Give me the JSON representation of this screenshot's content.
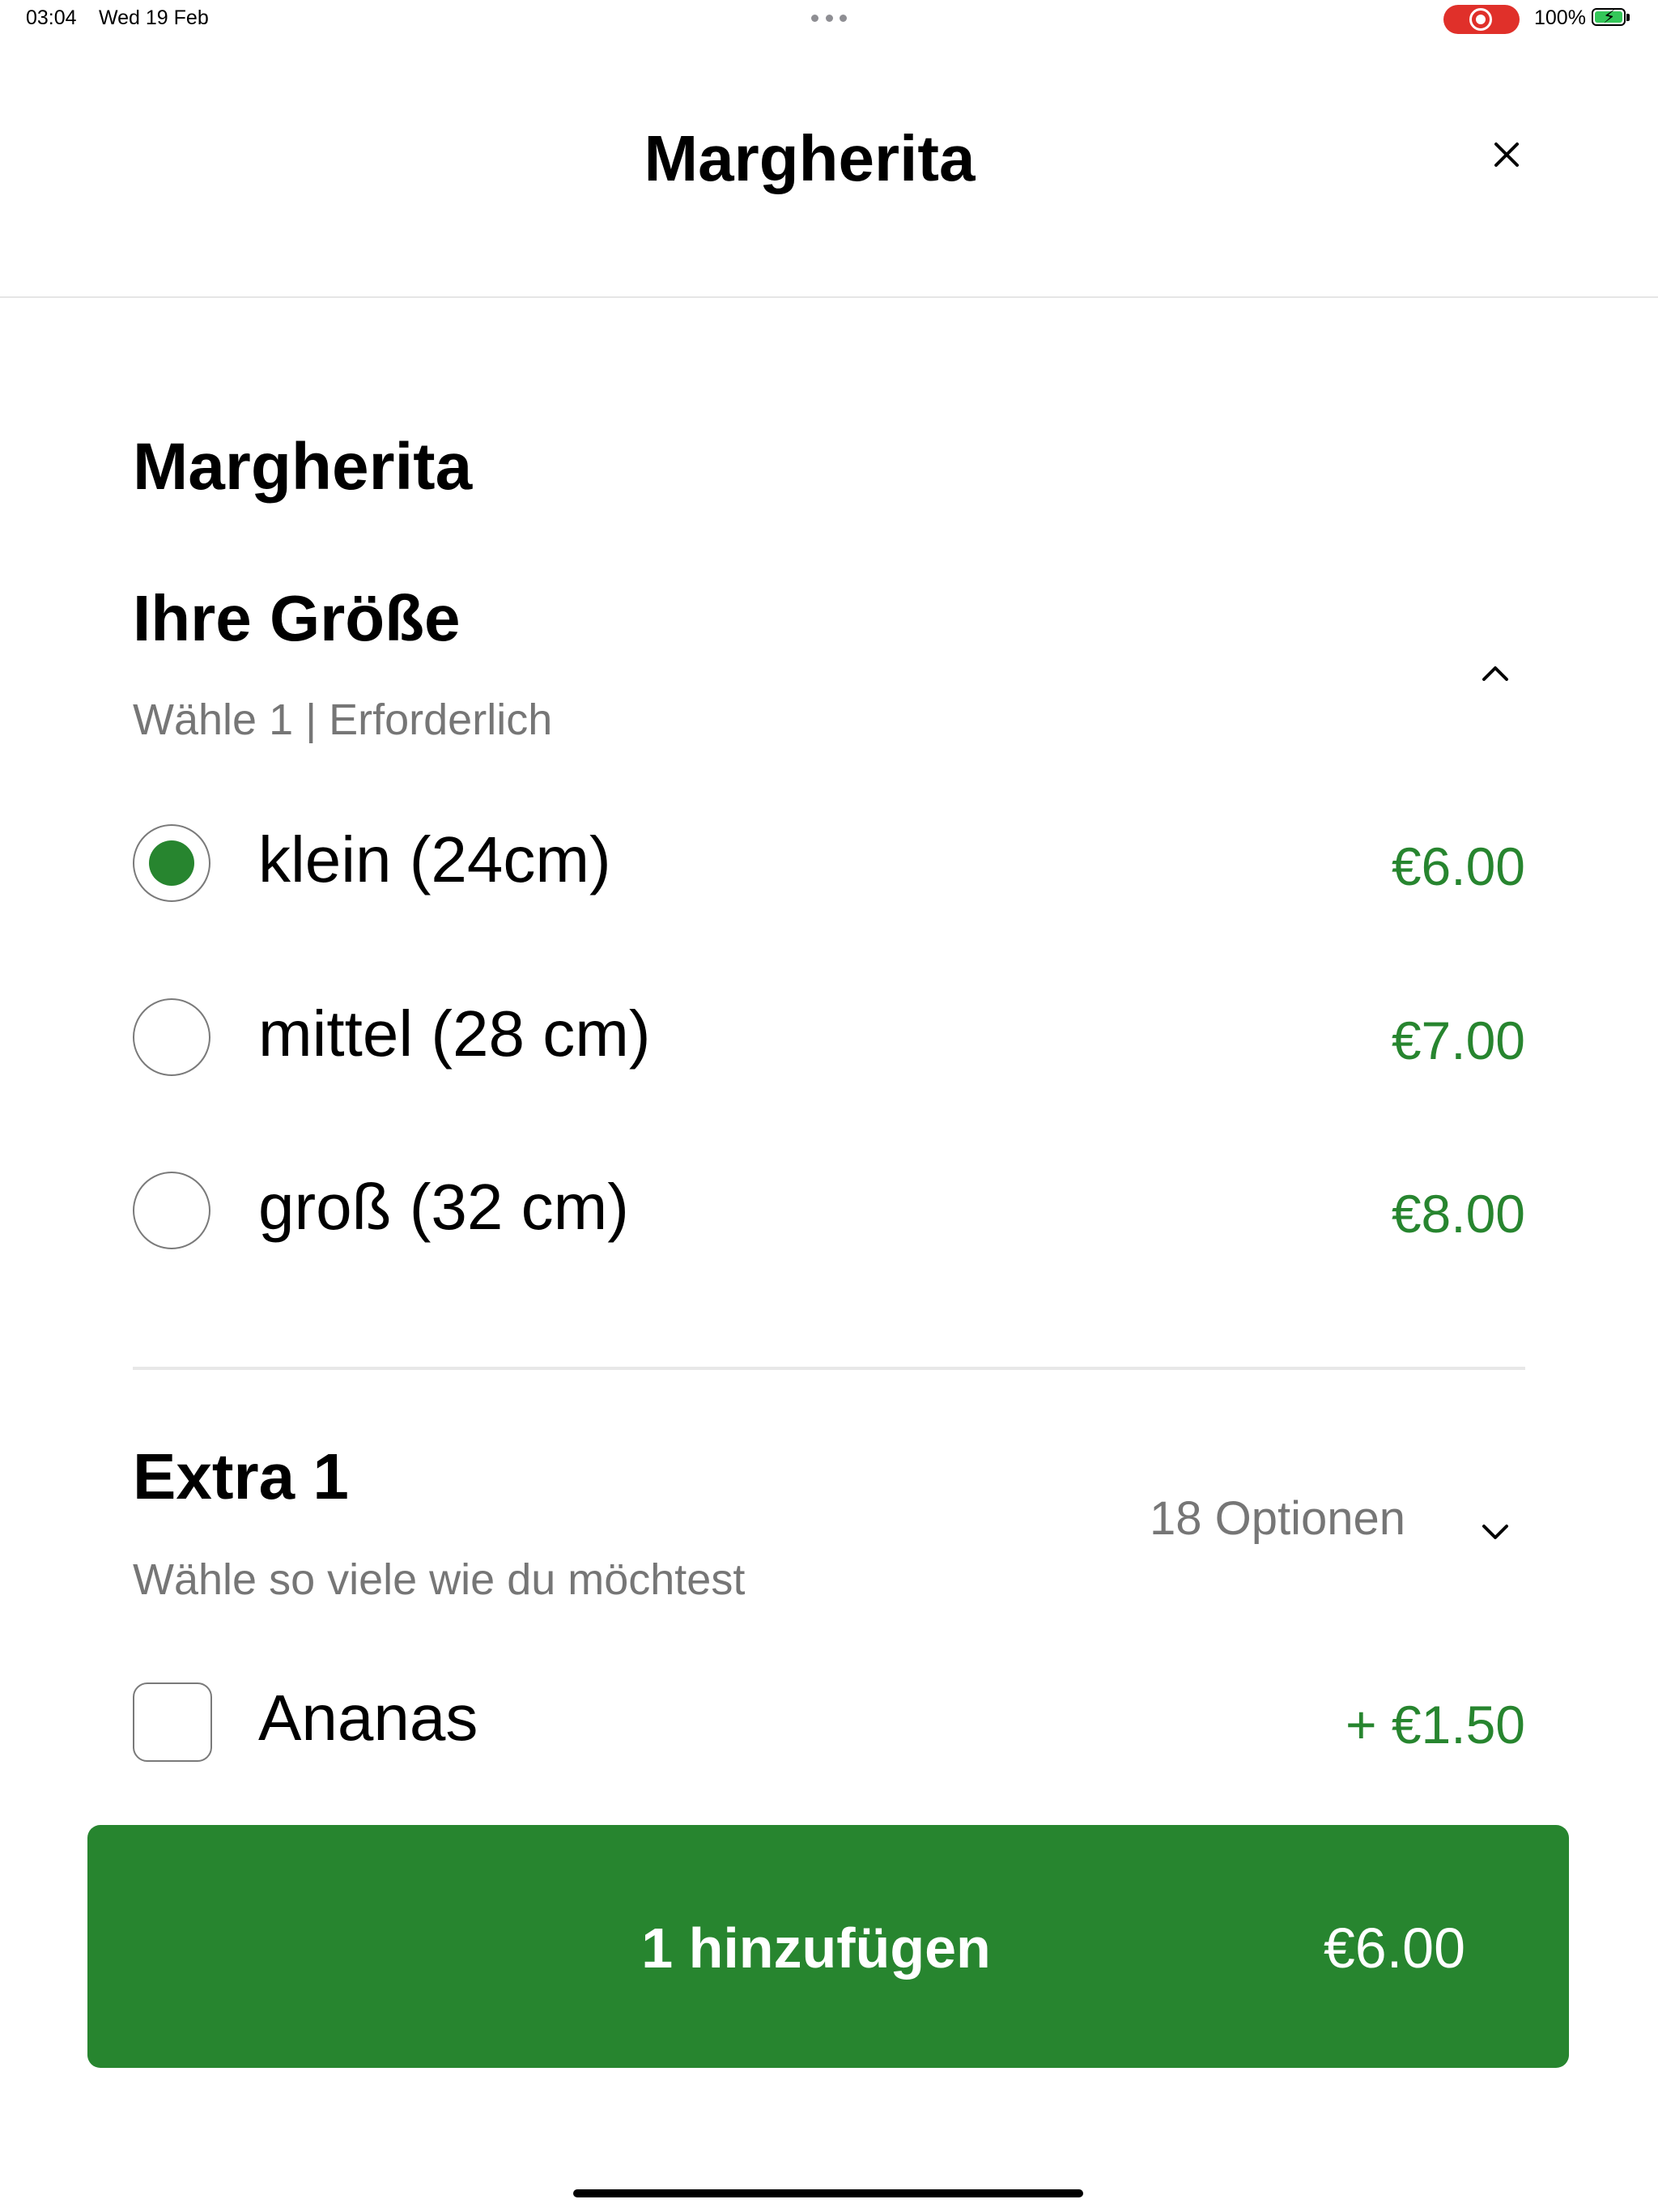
{
  "status_bar": {
    "time": "03:04",
    "date": "Wed 19 Feb",
    "battery": "100%"
  },
  "header": {
    "title": "Margherita",
    "close_icon": "close-icon"
  },
  "item": {
    "title": "Margherita"
  },
  "size_section": {
    "title": "Ihre Größe",
    "subtitle": "Wähle 1  |  Erforderlich",
    "options": [
      {
        "label": "klein (24cm)",
        "price": "€6.00",
        "selected": true
      },
      {
        "label": "mittel (28 cm)",
        "price": "€7.00",
        "selected": false
      },
      {
        "label": "groß (32 cm)",
        "price": "€8.00",
        "selected": false
      }
    ]
  },
  "extra_section": {
    "title": "Extra 1",
    "subtitle": "Wähle so viele wie du möchtest",
    "count": "18 Optionen",
    "options": [
      {
        "label": "Ananas",
        "price": "+ €1.50",
        "checked": false
      }
    ]
  },
  "add_button": {
    "label": "1 hinzufügen",
    "price": "€6.00"
  },
  "colors": {
    "accent": "#27852f",
    "recording": "#e0302a",
    "muted_text": "#767676"
  }
}
